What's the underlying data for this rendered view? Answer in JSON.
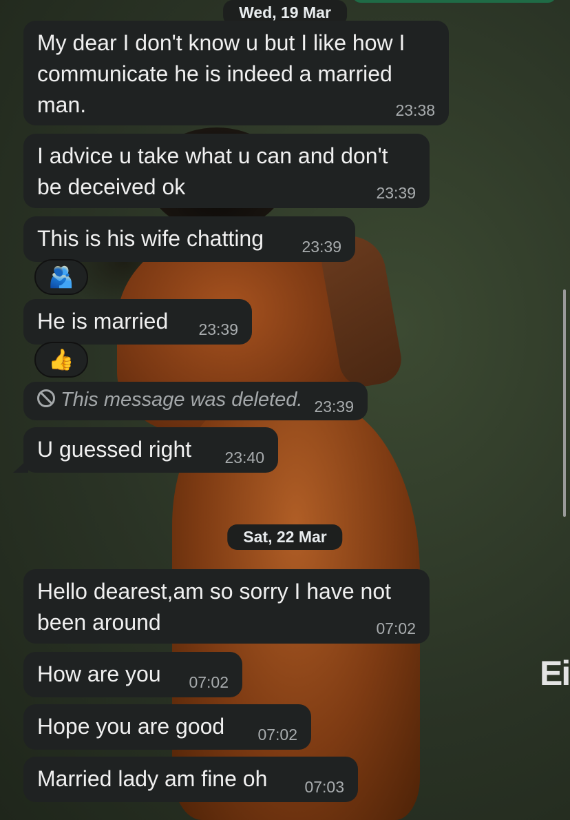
{
  "dates": [
    "Wed, 19 Mar",
    "Sat, 22 Mar"
  ],
  "messages": [
    {
      "text": "My dear  I don't know u but I like how I communicate he is indeed a married man.",
      "time": "23:38"
    },
    {
      "text": "I advice u take what u can and don't be deceived ok",
      "time": "23:39"
    },
    {
      "text": "This is his wife chatting",
      "time": "23:39",
      "reaction": "🫂"
    },
    {
      "text": "He is married",
      "time": "23:39",
      "reaction": "👍"
    },
    {
      "text": "This message was deleted.",
      "time": "23:39",
      "deleted": true
    },
    {
      "text": "U guessed right",
      "time": "23:40"
    },
    {
      "text": "Hello dearest,am so sorry I have not been around",
      "time": "07:02"
    },
    {
      "text": "How are you",
      "time": "07:02"
    },
    {
      "text": "Hope you are good",
      "time": "07:02"
    },
    {
      "text": "Married lady am fine oh",
      "time": "07:03"
    }
  ],
  "icons": {
    "deleted": "ban-icon"
  },
  "logo_text": "Ei",
  "colors": {
    "bubble": "#1f2222",
    "date_pill": "#1d1f1e",
    "timestamp": "#a9adaf"
  }
}
